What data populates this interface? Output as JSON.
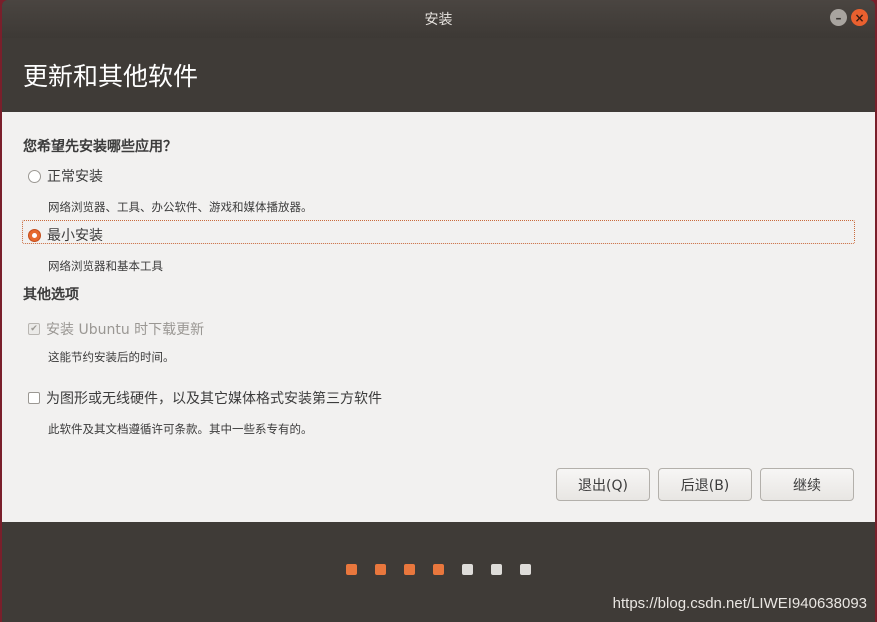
{
  "window": {
    "title": "安装"
  },
  "header": {
    "title": "更新和其他软件"
  },
  "install_type": {
    "question": "您希望先安装哪些应用？",
    "options": [
      {
        "label": "正常安装",
        "desc": "网络浏览器、工具、办公软件、游戏和媒体播放器。",
        "selected": false
      },
      {
        "label": "最小安装",
        "desc": "网络浏览器和基本工具",
        "selected": true
      }
    ]
  },
  "other_options": {
    "title": "其他选项",
    "items": [
      {
        "label": "安装 Ubuntu 时下载更新",
        "desc": "这能节约安装后的时间。",
        "checked": true,
        "disabled": true
      },
      {
        "label": "为图形或无线硬件，以及其它媒体格式安装第三方软件",
        "desc": "此软件及其文档遵循许可条款。其中一些系专有的。",
        "checked": false,
        "disabled": false
      }
    ]
  },
  "buttons": {
    "quit": "退出(Q)",
    "back": "后退(B)",
    "continue": "继续"
  },
  "progress": {
    "completed_steps": 4,
    "total_steps": 7
  },
  "watermark": "https://blog.csdn.net/LIWEI940638093",
  "colors": {
    "accent": "#e9773d",
    "titlebar": "#3f3b37",
    "content_bg": "#f2f1f0",
    "close": "#e9602f"
  }
}
